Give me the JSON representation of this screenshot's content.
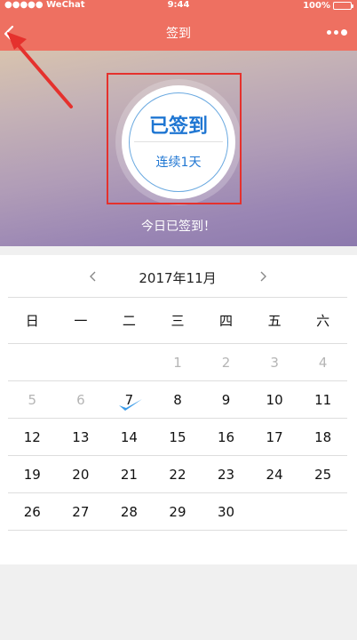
{
  "status_bar": {
    "carrier": "●●●●● WeChat",
    "time": "9:44",
    "battery": "100%"
  },
  "nav": {
    "title": "签到",
    "back_icon": "chevron-left-icon",
    "more_icon": "more-dots-icon"
  },
  "hero": {
    "signed_label": "已签到",
    "streak_label": "连续1天",
    "today_message": "今日已签到！"
  },
  "calendar": {
    "month_title": "2017年11月",
    "weekdays": [
      "日",
      "一",
      "二",
      "三",
      "四",
      "五",
      "六"
    ],
    "weeks": [
      [
        "",
        "",
        "",
        "1",
        "2",
        "3",
        "4"
      ],
      [
        "5",
        "6",
        "7",
        "8",
        "9",
        "10",
        "11"
      ],
      [
        "12",
        "13",
        "14",
        "15",
        "16",
        "17",
        "18"
      ],
      [
        "19",
        "20",
        "21",
        "22",
        "23",
        "24",
        "25"
      ],
      [
        "26",
        "27",
        "28",
        "29",
        "30",
        "",
        ""
      ]
    ],
    "muted_days": [
      "1",
      "2",
      "3",
      "4",
      "5",
      "6"
    ],
    "checked_day": "7"
  },
  "colors": {
    "header": "#ee7061",
    "accent": "#1f76d2",
    "check": "#3b9be8",
    "annotation": "#e5312d"
  }
}
